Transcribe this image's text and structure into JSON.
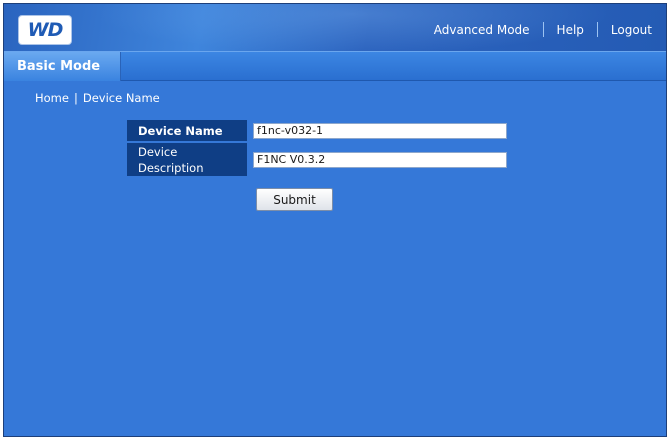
{
  "header": {
    "logo_text": "WD",
    "nav": {
      "advanced_mode": "Advanced Mode",
      "help": "Help",
      "logout": "Logout"
    }
  },
  "tabs": {
    "active": "Basic Mode"
  },
  "breadcrumb": {
    "home": "Home",
    "separator": "|",
    "current": "Device Name"
  },
  "form": {
    "device_name_label": "Device Name",
    "device_name_value": "f1nc-v032-1",
    "device_description_label_line1": "Device",
    "device_description_label_line2": "Description",
    "device_description_value": "F1NC V0.3.2",
    "submit_label": "Submit"
  },
  "colors": {
    "page_background": "#3578d8",
    "label_background": "#0f3e85",
    "header_background": "#2a64bf"
  }
}
